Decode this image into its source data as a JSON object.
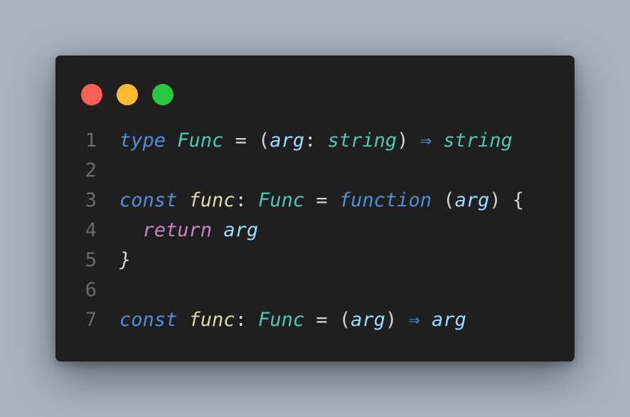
{
  "window": {
    "controls": [
      {
        "name": "close",
        "color": "#ff5f57"
      },
      {
        "name": "minimize",
        "color": "#febc2e"
      },
      {
        "name": "maximize",
        "color": "#28c840"
      }
    ]
  },
  "code": {
    "lines": [
      {
        "number": "1",
        "tokens": [
          "type",
          " ",
          "Func",
          " = (",
          "arg",
          ": ",
          "string",
          ") ",
          "⇒",
          " ",
          "string"
        ]
      },
      {
        "number": "2",
        "tokens": []
      },
      {
        "number": "3",
        "tokens": [
          "const",
          " ",
          "func",
          ": ",
          "Func",
          " = ",
          "function",
          " (",
          "arg",
          ") {"
        ]
      },
      {
        "number": "4",
        "tokens": [
          "  ",
          "return",
          " ",
          "arg"
        ]
      },
      {
        "number": "5",
        "tokens": [
          "}"
        ]
      },
      {
        "number": "6",
        "tokens": []
      },
      {
        "number": "7",
        "tokens": [
          "const",
          " ",
          "func",
          ": ",
          "Func",
          " = (",
          "arg",
          ") ",
          "⇒",
          " ",
          "arg"
        ]
      }
    ]
  },
  "colors": {
    "background": "#a7b3be",
    "editor": "#1f1f1f",
    "keyword": "#4f8fd6",
    "type": "#4ec9b0",
    "argument": "#9cdcfe",
    "function_name": "#dcdcaa",
    "return": "#c586c0",
    "line_number": "#6b6b6b"
  }
}
